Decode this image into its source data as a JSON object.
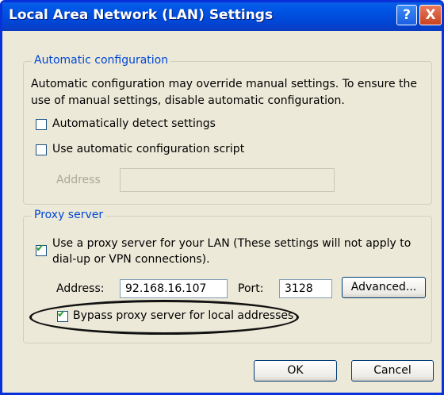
{
  "window": {
    "title": "Local Area Network (LAN) Settings",
    "help_glyph": "?",
    "close_glyph": "X"
  },
  "auto_config": {
    "legend": "Automatic configuration",
    "description_line1": "Automatic configuration may override manual settings.  To ensure the",
    "description_line2": "use of manual settings, disable automatic configuration.",
    "auto_detect_label": "Automatically detect settings",
    "auto_detect_checked": false,
    "use_script_label": "Use automatic configuration script",
    "use_script_checked": false,
    "address_label": "Address",
    "address_value": ""
  },
  "proxy": {
    "legend": "Proxy server",
    "use_proxy_line1": "Use a proxy server for your LAN (These settings will not apply to",
    "use_proxy_line2": "dial-up or VPN connections).",
    "use_proxy_checked": true,
    "address_label": "Address:",
    "address_value": "92.168.16.107",
    "port_label": "Port:",
    "port_value": "3128",
    "advanced_label": "Advanced...",
    "bypass_label": "Bypass proxy server for local addresses",
    "bypass_checked": true
  },
  "buttons": {
    "ok": "OK",
    "cancel": "Cancel"
  },
  "check_glyph": "✔",
  "colors": {
    "titlebar": "#0046d5",
    "legend_text": "#0046d5",
    "dialog_bg": "#ece9d8",
    "checkmark": "#21a121"
  }
}
